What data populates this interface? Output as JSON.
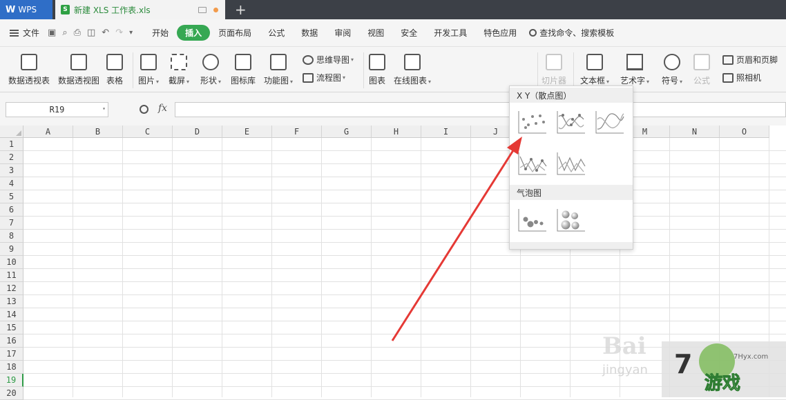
{
  "titlebar": {
    "app_tab": "WPS",
    "doc_tab": "新建 XLS 工作表.xls",
    "new_tab_symbol": "+"
  },
  "menu": {
    "file": "文件",
    "items": [
      "开始",
      "插入",
      "页面布局",
      "公式",
      "数据",
      "审阅",
      "视图",
      "安全",
      "开发工具",
      "特色应用"
    ],
    "active": "插入",
    "search": "查找命令、搜索模板"
  },
  "ribbon": {
    "pivot_table": "数据透视表",
    "pivot_chart": "数据透视图",
    "table": "表格",
    "picture": "图片",
    "screenshot": "截屏",
    "shape": "形状",
    "icon_library": "图标库",
    "function_chart": "功能图",
    "mind_map": "思维导图",
    "flowchart": "流程图",
    "chart": "图表",
    "online_chart": "在线图表",
    "slicer": "切片器",
    "text_box": "文本框",
    "word_art": "艺术字",
    "symbol": "符号",
    "formula": "公式",
    "header_footer": "页眉和页脚",
    "camera": "照相机"
  },
  "formula_bar": {
    "name_box": "R19",
    "fx_label": "fx",
    "value": ""
  },
  "sheet": {
    "columns": [
      "A",
      "B",
      "C",
      "D",
      "E",
      "F",
      "G",
      "H",
      "I",
      "J",
      "K",
      "L",
      "M",
      "N",
      "O"
    ],
    "rows": [
      "1",
      "2",
      "3",
      "4",
      "5",
      "6",
      "7",
      "8",
      "9",
      "10",
      "11",
      "12",
      "13",
      "14",
      "15",
      "16",
      "17",
      "18",
      "19",
      "20"
    ],
    "selected_row": "19"
  },
  "dropdown": {
    "section_xy": "X Y（散点图）",
    "section_bubble": "气泡图",
    "xy_types": [
      "scatter",
      "smooth-line-markers",
      "smooth-line",
      "straight-line-markers",
      "straight-line"
    ],
    "bubble_types": [
      "bubble",
      "3d-bubble"
    ]
  },
  "watermarks": {
    "baidu": "Bai",
    "jingyan": "jingyan",
    "seven": "7",
    "game": "游戏",
    "site": "7Hyx.com"
  },
  "colors": {
    "accent_green": "#36a853",
    "titlebar": "#3c4047",
    "wps_blue": "#2f6ec7",
    "arrow_red": "#e53935"
  }
}
